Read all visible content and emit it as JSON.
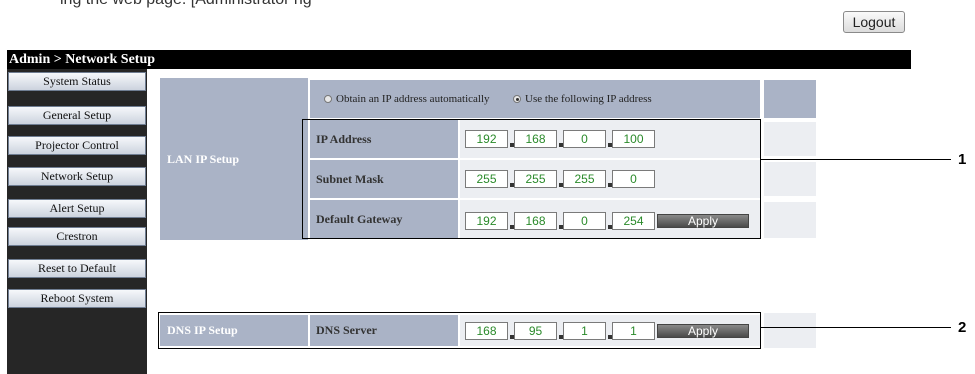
{
  "top_text": "ing the web page. [Administrator rig",
  "header": {
    "logout_label": "Logout",
    "title": "Admin > Network Setup"
  },
  "sidebar": {
    "items": [
      {
        "label": "System Status"
      },
      {
        "label": "General Setup"
      },
      {
        "label": "Projector Control"
      },
      {
        "label": "Network Setup"
      },
      {
        "label": "Alert Setup"
      },
      {
        "label": "Crestron"
      },
      {
        "label": "Reset to Default"
      },
      {
        "label": "Reboot System"
      }
    ]
  },
  "lan": {
    "header": "LAN IP Setup",
    "radio_auto": {
      "label": "Obtain an IP address automatically",
      "selected": false
    },
    "radio_manual": {
      "label": "Use the following IP address",
      "selected": true
    },
    "rows": [
      {
        "label": "IP Address",
        "octets": [
          "192",
          "168",
          "0",
          "100"
        ]
      },
      {
        "label": "Subnet Mask",
        "octets": [
          "255",
          "255",
          "255",
          "0"
        ]
      },
      {
        "label": "Default Gateway",
        "octets": [
          "192",
          "168",
          "0",
          "254"
        ]
      }
    ],
    "apply_label": "Apply"
  },
  "dns": {
    "header": "DNS IP Setup",
    "row": {
      "label": "DNS Server",
      "octets": [
        "168",
        "95",
        "1",
        "1"
      ]
    },
    "apply_label": "Apply"
  },
  "callouts": {
    "one": "1",
    "two": "2"
  }
}
